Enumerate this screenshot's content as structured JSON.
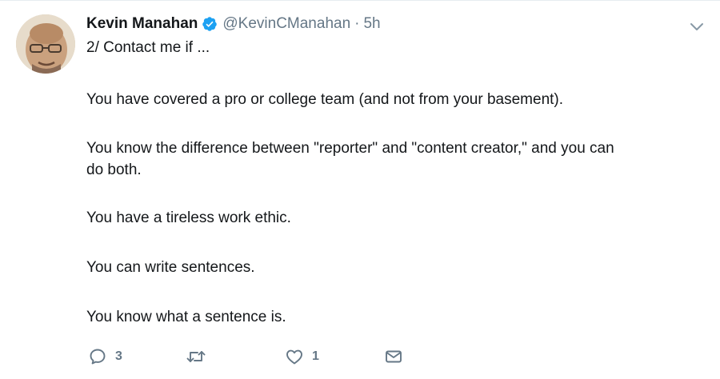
{
  "tweet": {
    "author": {
      "display_name": "Kevin Manahan",
      "handle": "@KevinCManahan",
      "verified": true
    },
    "separator": "·",
    "timestamp": "5h",
    "lines": [
      "2/ Contact me if ...",
      "You have covered a pro or college team (and not from your basement).",
      "You know the difference between \"reporter\" and \"content creator,\" and you can",
      "do both.",
      "You have a tireless work ethic.",
      "You can write sentences.",
      "You know what a sentence is."
    ],
    "actions": {
      "reply_count": "3",
      "retweet_count": "",
      "like_count": "1"
    }
  },
  "icons": {
    "verified": "verified-badge-icon",
    "caret": "chevron-down-icon",
    "reply": "reply-icon",
    "retweet": "retweet-icon",
    "like": "heart-icon",
    "dm": "envelope-icon"
  },
  "colors": {
    "text": "#14171a",
    "muted": "#657786",
    "verified_blue": "#1da1f2",
    "divider": "#e6ecf0"
  }
}
